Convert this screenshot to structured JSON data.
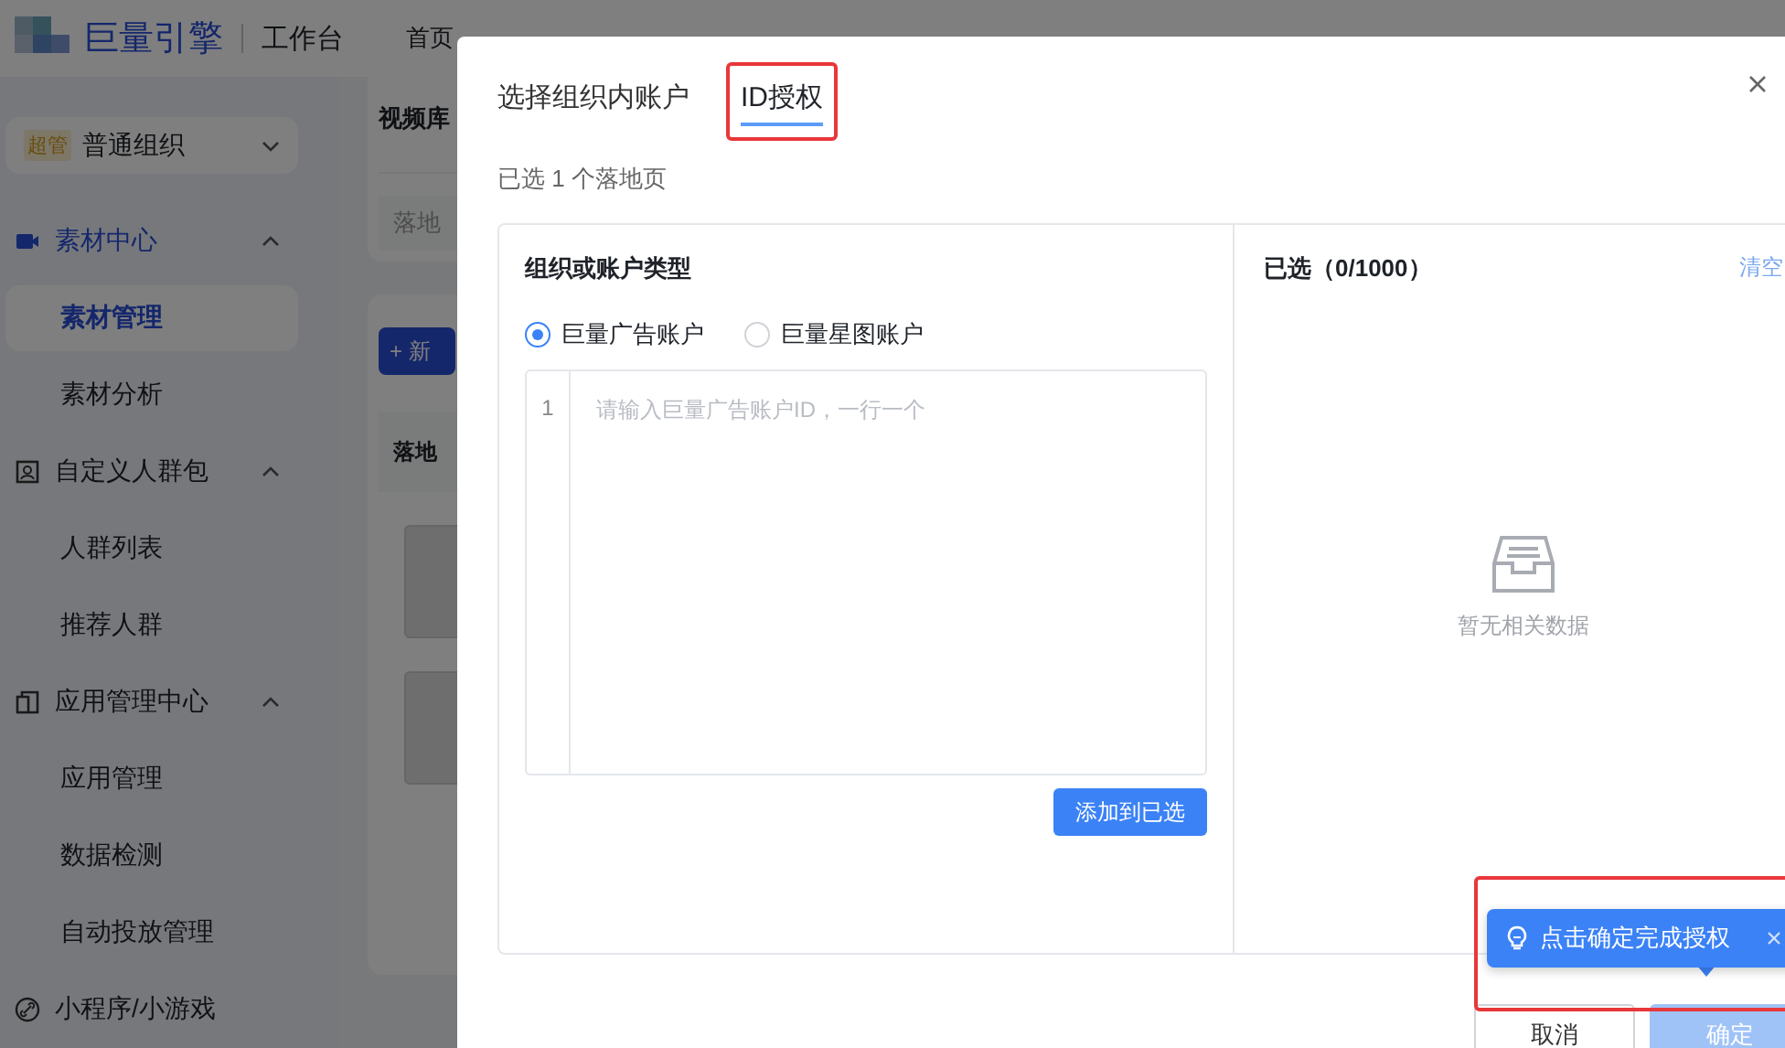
{
  "header": {
    "logo": "巨量引擎",
    "product": "工作台",
    "nav": [
      {
        "label": "首页",
        "selected": false
      }
    ]
  },
  "sidebar": {
    "org": {
      "badge": "超管",
      "name": "普通组织"
    },
    "groups": [
      {
        "label": "素材中心",
        "expanded": true,
        "selected": true,
        "children": [
          {
            "label": "素材管理",
            "selected": true
          },
          {
            "label": "素材分析",
            "selected": false
          }
        ]
      },
      {
        "label": "自定义人群包",
        "expanded": true,
        "selected": false,
        "children": [
          {
            "label": "人群列表",
            "selected": false
          },
          {
            "label": "推荐人群",
            "selected": false
          }
        ]
      },
      {
        "label": "应用管理中心",
        "expanded": true,
        "selected": false,
        "children": [
          {
            "label": "应用管理",
            "selected": false
          },
          {
            "label": "数据检测",
            "selected": false
          },
          {
            "label": "自动投放管理",
            "selected": false
          }
        ]
      },
      {
        "label": "小程序/小游戏",
        "selected": false
      }
    ]
  },
  "main": {
    "library_title": "视频库",
    "search_placeholder": "落地",
    "new_button": "+ 新",
    "table_header": "落地"
  },
  "modal": {
    "tabs": [
      {
        "label": "选择组织内账户",
        "selected": false,
        "annotated": false
      },
      {
        "label": "ID授权",
        "selected": true,
        "annotated": true
      }
    ],
    "summary": "已选 1 个落地页",
    "left": {
      "title": "组织或账户类型",
      "radios": [
        {
          "label": "巨量广告账户",
          "selected": true
        },
        {
          "label": "巨量星图账户",
          "selected": false
        }
      ],
      "line_number": "1",
      "placeholder": "请输入巨量广告账户ID，一行一个",
      "add_button": "添加到已选"
    },
    "right": {
      "title": "已选（0/1000）",
      "clear": "清空",
      "empty": "暂无相关数据"
    },
    "buttons": [
      {
        "label": "取消",
        "kind": "secondary",
        "disabled": false
      },
      {
        "label": "确定",
        "kind": "primary",
        "disabled": true
      }
    ],
    "tooltip": {
      "text": "点击确定完成授权",
      "annotated": true
    }
  }
}
